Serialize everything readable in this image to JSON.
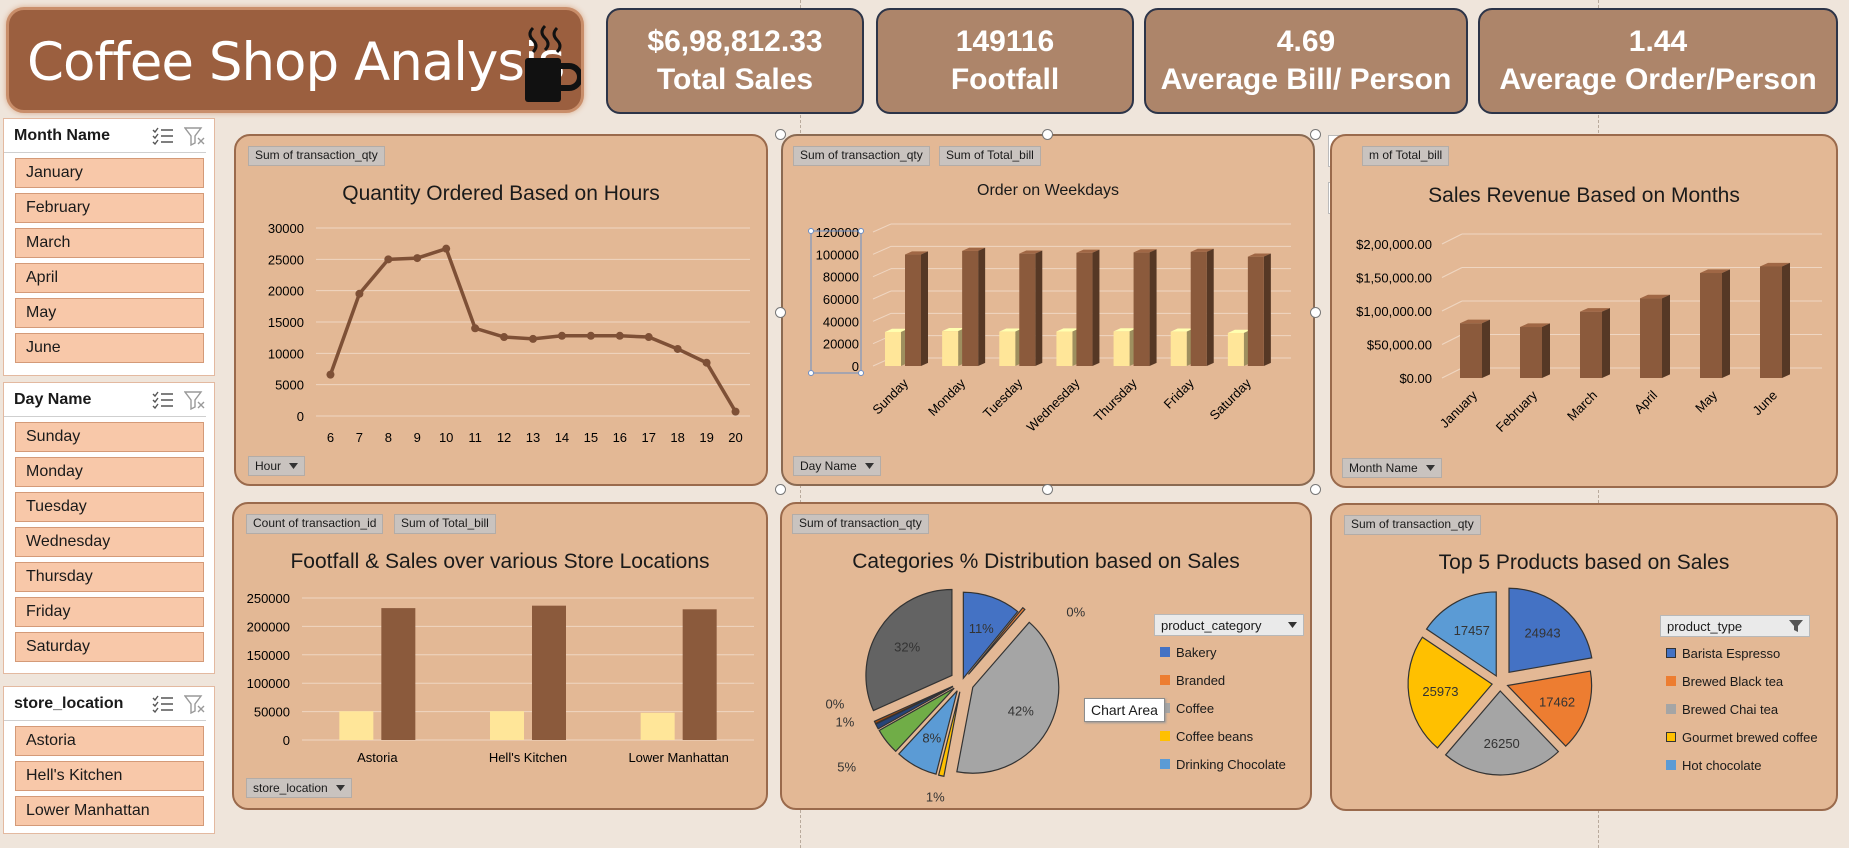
{
  "title": "Coffee Shop Analysis",
  "kpis": [
    {
      "value": "$6,98,812.33",
      "label": "Total Sales"
    },
    {
      "value": "149116",
      "label": "Footfall"
    },
    {
      "value": "4.69",
      "label": "Average Bill/ Person"
    },
    {
      "value": "1.44",
      "label": "Average Order/Person"
    }
  ],
  "slicers": {
    "month": {
      "header": "Month Name",
      "items": [
        "January",
        "February",
        "March",
        "April",
        "May",
        "June"
      ]
    },
    "day": {
      "header": "Day Name",
      "items": [
        "Sunday",
        "Monday",
        "Tuesday",
        "Wednesday",
        "Thursday",
        "Friday",
        "Saturday"
      ]
    },
    "store": {
      "header": "store_location",
      "items": [
        "Astoria",
        "Hell's Kitchen",
        "Lower Manhattan"
      ]
    }
  },
  "panels": {
    "hours": {
      "fields": [
        "Sum of transaction_qty"
      ],
      "axis_field": "Hour"
    },
    "weekdays": {
      "fields": [
        "Sum of transaction_qty",
        "Sum of Total_bill"
      ],
      "axis_field": "Day Name"
    },
    "months": {
      "fields": [
        "m of Total_bill"
      ],
      "axis_field": "Month Name"
    },
    "stores": {
      "fields": [
        "Count of transaction_id",
        "Sum of Total_bill"
      ],
      "axis_field": "store_location"
    },
    "categories": {
      "fields": [
        "Sum of transaction_qty"
      ],
      "legend_field": "product_category",
      "tooltip": "Chart Area"
    },
    "products": {
      "fields": [
        "Sum of transaction_qty"
      ],
      "legend_field": "product_type"
    }
  },
  "colors": {
    "line": "#7e5036",
    "bar_light": "#ffe699",
    "bar_dark": "#8b5a3c",
    "title_bg": "#9b5f3f",
    "kpi_bg": "#ad856a",
    "panel_bg": "#e3b895",
    "slicer_item": "#f8c8a9"
  },
  "chart_data": [
    {
      "id": "hours",
      "type": "line",
      "title": "Quantity Ordered Based on Hours",
      "x": [
        6,
        7,
        8,
        9,
        10,
        11,
        12,
        13,
        14,
        15,
        16,
        17,
        18,
        19,
        20
      ],
      "values": [
        6600,
        19500,
        25000,
        25200,
        26700,
        14000,
        12600,
        12300,
        12800,
        12800,
        12800,
        12600,
        10700,
        8500,
        700
      ],
      "ylim": [
        0,
        30000
      ],
      "yticks": [
        "0",
        "5000",
        "10000",
        "15000",
        "20000",
        "25000",
        "30000"
      ]
    },
    {
      "id": "weekdays",
      "type": "bar",
      "title": "Order on Weekdays",
      "categories": [
        "Sunday",
        "Monday",
        "Tuesday",
        "Wednesday",
        "Thursday",
        "Friday",
        "Saturday"
      ],
      "series": [
        {
          "values": [
            30500,
            31200,
            30800,
            30900,
            31000,
            30800,
            29600
          ]
        },
        {
          "values": [
            99800,
            103100,
            100600,
            101400,
            101700,
            102200,
            97900
          ]
        }
      ],
      "ylim": [
        0,
        120000
      ],
      "yticks": [
        "0",
        "20000",
        "40000",
        "60000",
        "80000",
        "100000",
        "120000"
      ]
    },
    {
      "id": "months",
      "type": "bar",
      "title": "Sales Revenue Based on Months",
      "categories": [
        "January",
        "February",
        "March",
        "April",
        "May",
        "June"
      ],
      "values": [
        81700,
        76100,
        99000,
        118900,
        156700,
        166500
      ],
      "ylim": [
        0,
        200000
      ],
      "yticks": [
        "$0.00",
        "$50,000.00",
        "$1,00,000.00",
        "$1,50,000.00",
        "$2,00,000.00"
      ]
    },
    {
      "id": "stores",
      "type": "bar",
      "title": "Footfall & Sales over various Store Locations",
      "categories": [
        "Astoria",
        "Hell's Kitchen",
        "Lower Manhattan"
      ],
      "series": [
        {
          "values": [
            50600,
            50700,
            47800
          ]
        },
        {
          "values": [
            232200,
            236500,
            230100
          ]
        }
      ],
      "ylim": [
        0,
        250000
      ],
      "yticks": [
        "0",
        "50000",
        "100000",
        "150000",
        "200000",
        "250000"
      ]
    },
    {
      "id": "categories",
      "type": "pie",
      "title": "Categories % Distribution based on Sales",
      "categories": [
        "Bakery",
        "Branded",
        "Coffee",
        "Coffee beans",
        "Drinking Chocolate"
      ],
      "legend_colors": [
        "#4472c4",
        "#ed7d31",
        "#a5a5a5",
        "#ffc000",
        "#5b9bd5"
      ],
      "slices": [
        {
          "value": 11,
          "label": "11%",
          "color": "#4472c4"
        },
        {
          "value": 0.5,
          "label": "0%",
          "color": "#ed7d31"
        },
        {
          "value": 42,
          "label": "42%",
          "color": "#a5a5a5"
        },
        {
          "value": 1,
          "label": "1%",
          "color": "#ffc000"
        },
        {
          "value": 8,
          "label": "8%",
          "color": "#5b9bd5"
        },
        {
          "value": 5,
          "label": "5%",
          "color": "#70ad47"
        },
        {
          "value": 1,
          "label": "1%",
          "color": "#264478"
        },
        {
          "value": 0.5,
          "label": "0%",
          "color": "#9e480e"
        },
        {
          "value": 32,
          "label": "32%",
          "color": "#636363"
        }
      ]
    },
    {
      "id": "products",
      "type": "pie",
      "title": "Top 5 Products based on Sales",
      "categories": [
        "Barista Espresso",
        "Brewed Black tea",
        "Brewed Chai tea",
        "Gourmet brewed coffee",
        "Hot chocolate"
      ],
      "legend_colors": [
        "#4472c4",
        "#ed7d31",
        "#a5a5a5",
        "#ffc000",
        "#5b9bd5"
      ],
      "slices": [
        {
          "value": 24943,
          "label": "24943",
          "color": "#4472c4"
        },
        {
          "value": 17462,
          "label": "17462",
          "color": "#ed7d31"
        },
        {
          "value": 26250,
          "label": "26250",
          "color": "#a5a5a5"
        },
        {
          "value": 25973,
          "label": "25973",
          "color": "#ffc000"
        },
        {
          "value": 17457,
          "label": "17457",
          "color": "#5b9bd5"
        }
      ]
    }
  ]
}
